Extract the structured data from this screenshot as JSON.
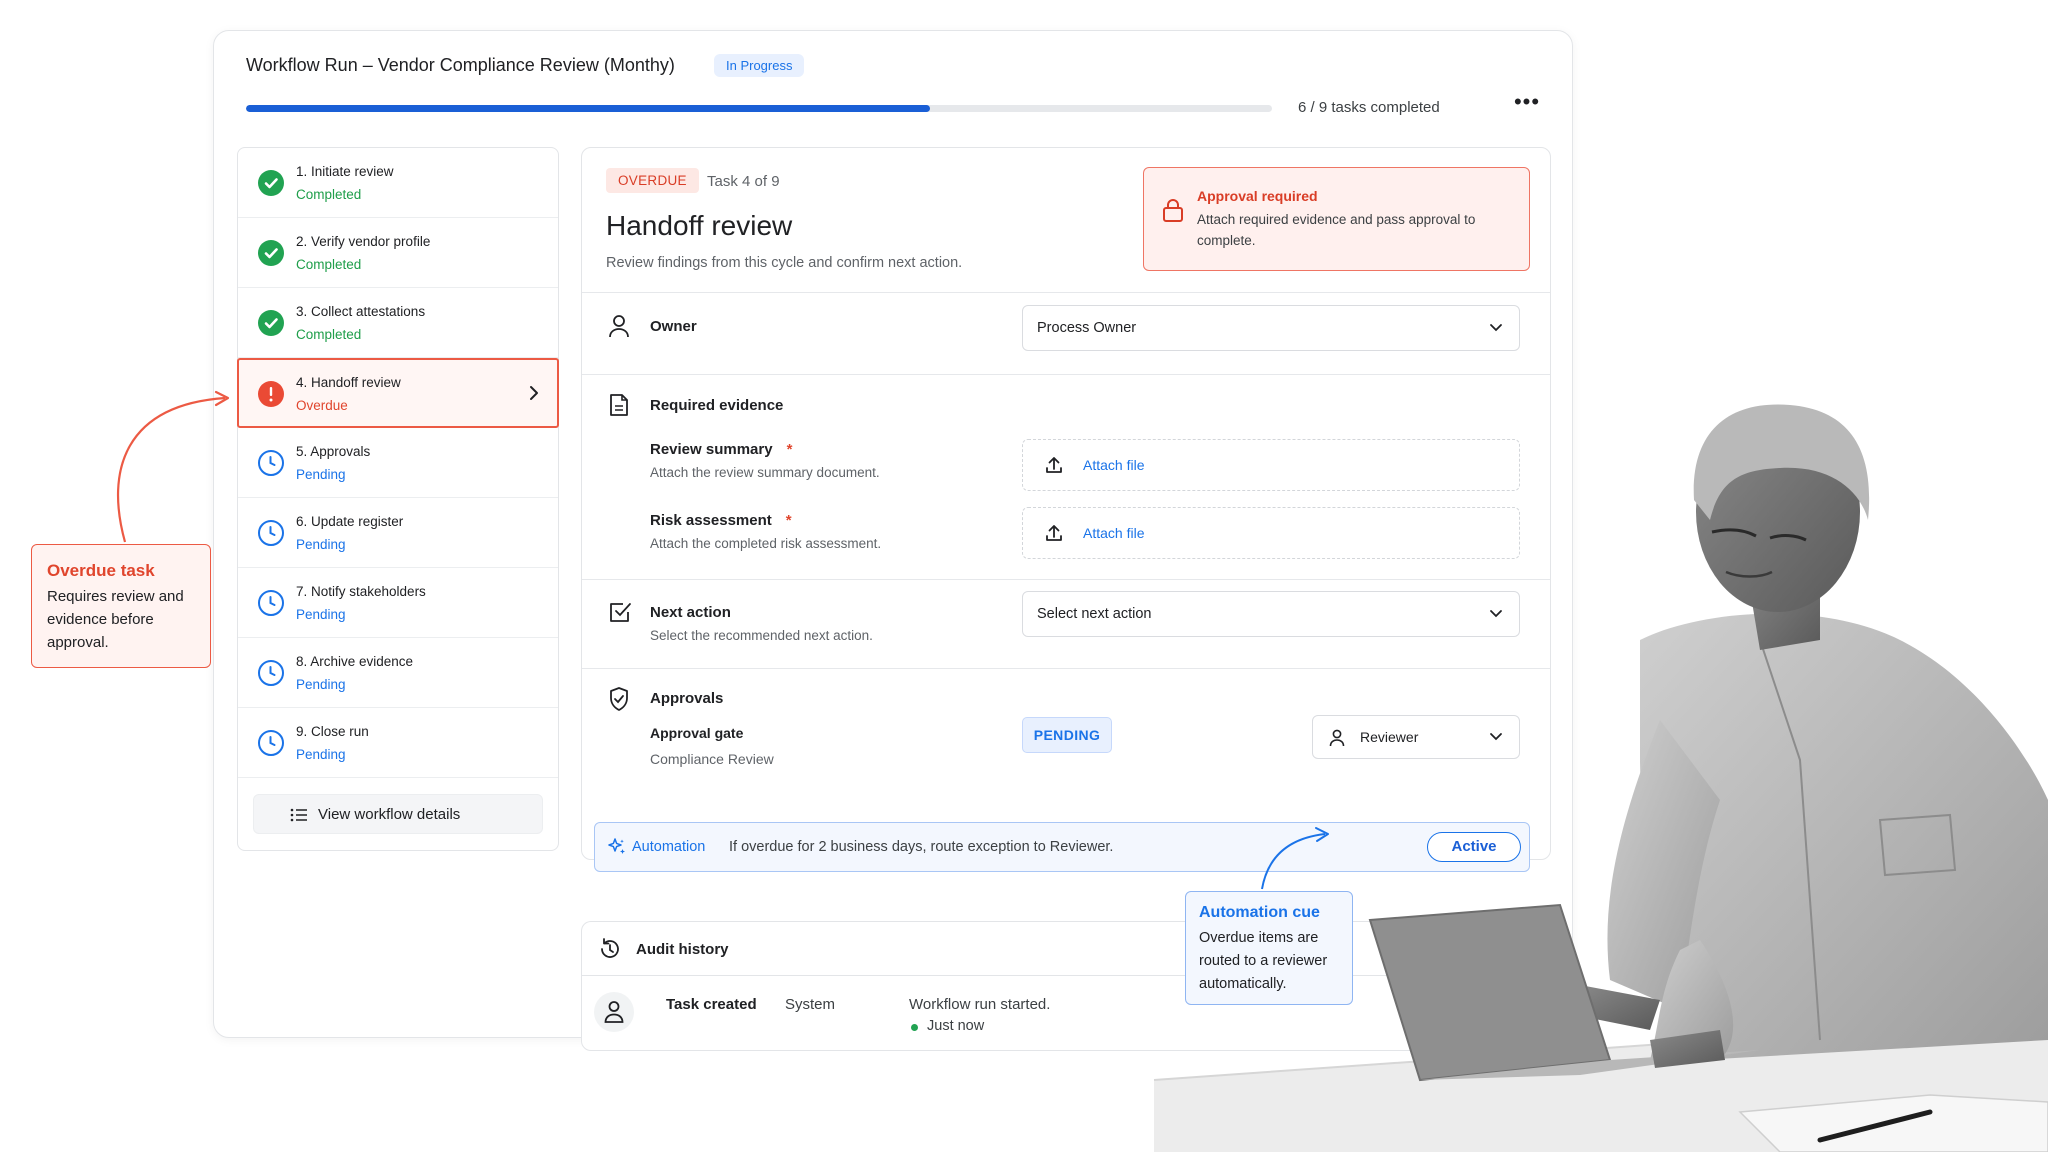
{
  "window": {
    "title": "Workflow Run – Vendor Compliance Review (Monthy)",
    "status": "In Progress",
    "progress_fraction": 0.667,
    "progress_text": "6 / 9 tasks completed",
    "more": "•••"
  },
  "steps": [
    {
      "label": "1. Initiate review",
      "status": "Completed",
      "state": "done"
    },
    {
      "label": "2. Verify vendor profile",
      "status": "Completed",
      "state": "done"
    },
    {
      "label": "3. Collect attestations",
      "status": "Completed",
      "state": "done"
    },
    {
      "label": "4. Handoff review",
      "status": "Overdue",
      "state": "over"
    },
    {
      "label": "5. Approvals",
      "status": "Pending",
      "state": "pend"
    },
    {
      "label": "6. Update register",
      "status": "Pending",
      "state": "pend"
    },
    {
      "label": "7. Notify stakeholders",
      "status": "Pending",
      "state": "pend"
    },
    {
      "label": "8. Archive evidence",
      "status": "Pending",
      "state": "pend"
    },
    {
      "label": "9. Close run",
      "status": "Pending",
      "state": "pend"
    }
  ],
  "sidebar": {
    "view_details": "View workflow details"
  },
  "task": {
    "badge": "OVERDUE",
    "position": "Task 4 of 9",
    "title": "Handoff review",
    "description": "Review findings from this cycle and confirm next action."
  },
  "alert": {
    "title": "Approval required",
    "text": "Attach required evidence and pass approval to complete."
  },
  "owner": {
    "label": "Owner",
    "value": "Process Owner"
  },
  "evidence": {
    "title": "Required evidence",
    "items": [
      {
        "title": "Review summary",
        "required": "*",
        "sub": "Attach the review summary document.",
        "action": "Attach file"
      },
      {
        "title": "Risk assessment",
        "required": "*",
        "sub": "Attach the completed risk assessment.",
        "action": "Attach file"
      }
    ]
  },
  "next_action": {
    "title": "Next action",
    "sub": "Select the recommended next action.",
    "value": "Select next action"
  },
  "approvals": {
    "title": "Approvals",
    "gate_title": "Approval gate",
    "gate_sub": "Compliance Review",
    "status": "PENDING",
    "reviewer": "Reviewer"
  },
  "automation": {
    "label": "Automation",
    "text": "If overdue for 2 business days, route exception to Reviewer.",
    "state": "Active"
  },
  "audit": {
    "title": "Audit history",
    "event": "Task created",
    "actor": "System",
    "detail": "Workflow run started.",
    "time": "Just now"
  },
  "callouts": {
    "overdue_title": "Overdue task",
    "overdue_text": "Requires review and evidence before approval.",
    "automation_title": "Automation cue",
    "automation_text": "Overdue items are routed to a reviewer automatically."
  },
  "colors": {
    "accent": "#1a73e8",
    "success": "#21a352",
    "danger": "#ea4a35",
    "progress": "#1a5fd6"
  }
}
